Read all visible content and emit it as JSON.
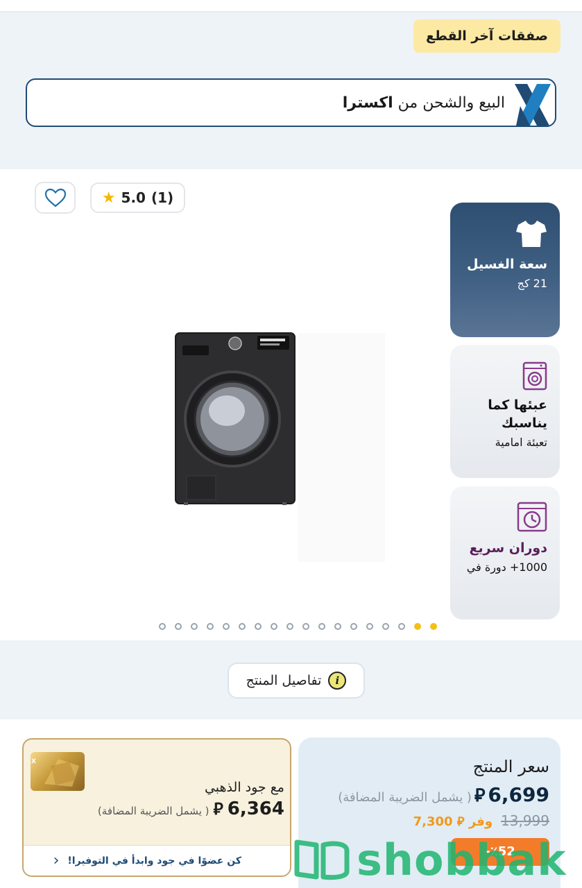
{
  "deals": {
    "badge_label": "صفقات آخر القطع"
  },
  "xtra_banner": {
    "text_prefix": "البيع والشحن من ",
    "text_brand": "اكسترا",
    "logo_icon": "x-logo-icon"
  },
  "rating": {
    "score": "5.0",
    "count": "(1)"
  },
  "features": [
    {
      "icon": "tshirt-icon",
      "title": "سعة الغسيل",
      "subtitle": "21 كج"
    },
    {
      "icon": "washer-front-load-icon",
      "title": "عبئها كما يناسبك",
      "subtitle": "تعبئة امامية"
    },
    {
      "icon": "washer-spin-icon",
      "title": "دوران سريع",
      "subtitle": "1000+ دورة في"
    }
  ],
  "gallery": {
    "total_dots": 18,
    "active_indices": [
      16,
      17
    ]
  },
  "details_button": {
    "label": "تفاصيل المنتج"
  },
  "price": {
    "title": "سعر المنتج",
    "current": "6,699",
    "vat_note": "( يشمل الضريبة المضافة)",
    "old": "13,999",
    "save_prefix": "وفر",
    "save_amount": "7,300",
    "discount_tag": "٪52-"
  },
  "gold": {
    "title": "مع جود الذهبي",
    "price": "6,364",
    "vat_note": "( يشمل الضريبة المضافة)",
    "cta": "كن عضوًا في جود وابدأ في التوفيرا!"
  },
  "watermark": {
    "text": "shobbak"
  },
  "colors": {
    "navy": "#1f4b75",
    "gold_badge": "#fce9a3",
    "orange": "#f09a1a",
    "green": "#1fb571"
  }
}
